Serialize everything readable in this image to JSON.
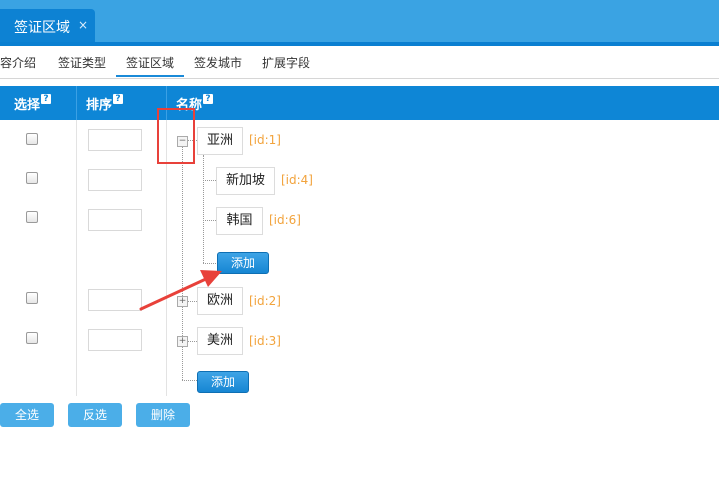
{
  "top_tab": {
    "title": "签证区域",
    "close": "×"
  },
  "subtabs": [
    "容介绍",
    "签证类型",
    "签证区域",
    "签发城市",
    "扩展字段"
  ],
  "table_header": {
    "select": "选择",
    "sort": "排序",
    "name": "名称",
    "help": "?"
  },
  "tree": {
    "asia": {
      "name": "亚洲",
      "id": "[id:1]",
      "toggle": "−"
    },
    "singapore": {
      "name": "新加坡",
      "id": "[id:4]"
    },
    "korea": {
      "name": "韩国",
      "id": "[id:6]"
    },
    "add_child": "添加",
    "europe": {
      "name": "欧洲",
      "id": "[id:2]",
      "toggle": "+"
    },
    "america": {
      "name": "美洲",
      "id": "[id:3]",
      "toggle": "+"
    },
    "add_root": "添加"
  },
  "buttons": {
    "select_all": "全选",
    "invert": "反选",
    "delete": "删除"
  },
  "colors": {
    "header_blue": "#0e86d6",
    "id_orange": "#f2a33c",
    "annotation_red": "#e8413a"
  }
}
